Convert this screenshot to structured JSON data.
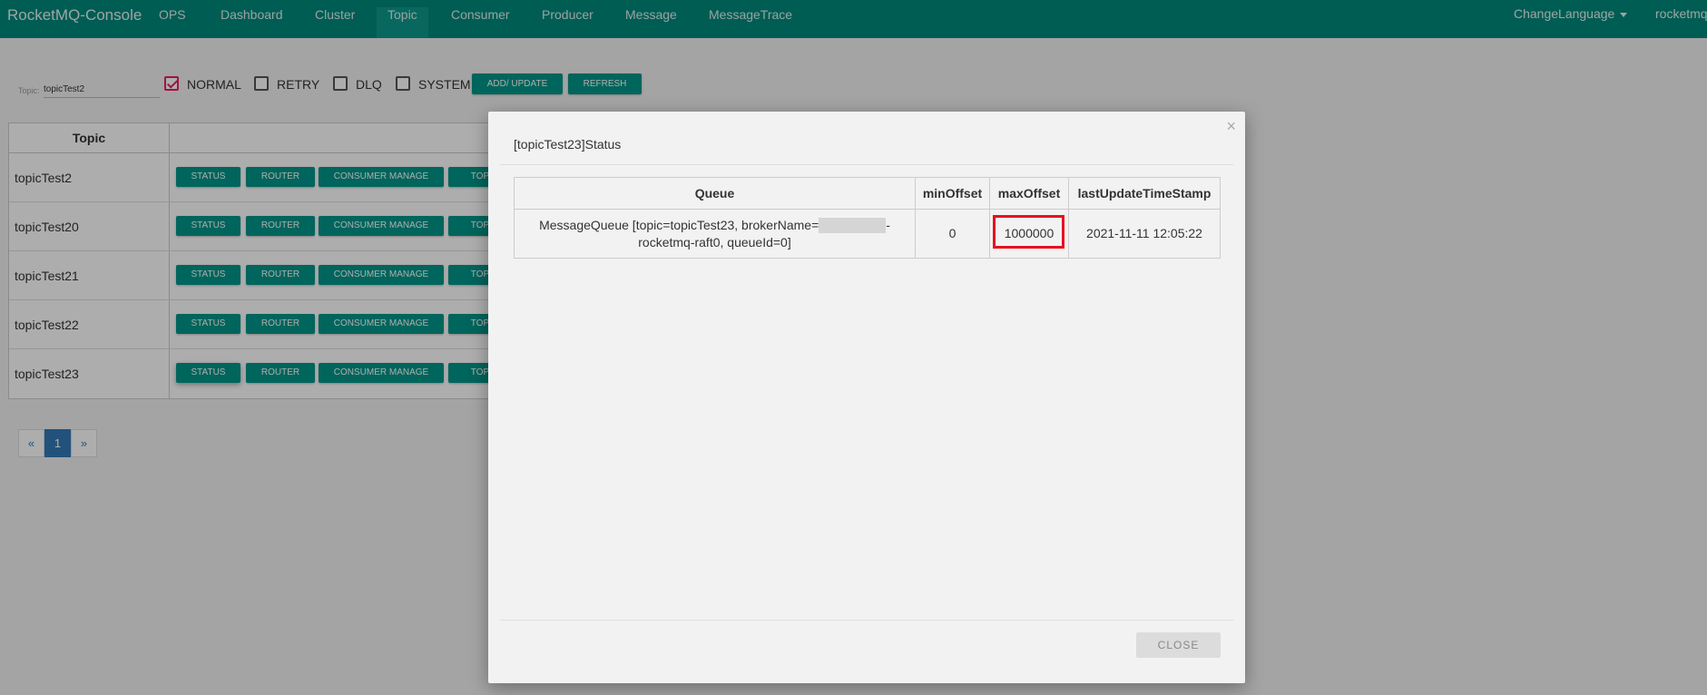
{
  "navbar": {
    "brand": "RocketMQ-Console",
    "items": [
      {
        "label": "OPS"
      },
      {
        "label": "Dashboard"
      },
      {
        "label": "Cluster"
      },
      {
        "label": "Topic"
      },
      {
        "label": "Consumer"
      },
      {
        "label": "Producer"
      },
      {
        "label": "Message"
      },
      {
        "label": "MessageTrace"
      }
    ],
    "active_item": "Topic",
    "change_language": "ChangeLanguage",
    "user": "rocketmq"
  },
  "filter": {
    "topic_label": "Topic:",
    "topic_value": "topicTest2",
    "checkboxes": [
      {
        "label": "NORMAL",
        "checked": true
      },
      {
        "label": "RETRY",
        "checked": false
      },
      {
        "label": "DLQ",
        "checked": false
      },
      {
        "label": "SYSTEM",
        "checked": false
      }
    ],
    "add_update_label": "ADD/ UPDATE",
    "refresh_label": "REFRESH"
  },
  "topic_table": {
    "header": "Topic",
    "row_buttons": {
      "status": "STATUS",
      "router": "ROUTER",
      "consumer_manage": "CONSUMER MANAGE",
      "topic_config": "TOPIC"
    },
    "rows": [
      {
        "name": "topicTest2"
      },
      {
        "name": "topicTest20"
      },
      {
        "name": "topicTest21"
      },
      {
        "name": "topicTest22"
      },
      {
        "name": "topicTest23"
      }
    ]
  },
  "pagination": {
    "prev": "«",
    "current": "1",
    "next": "»"
  },
  "modal": {
    "close_x": "×",
    "title": "[topicTest23]Status",
    "columns": {
      "queue": "Queue",
      "min_offset": "minOffset",
      "max_offset": "maxOffset",
      "last_update": "lastUpdateTimeStamp"
    },
    "row": {
      "queue_line1_prefix": "MessageQueue [topic=topicTest23, brokerName=",
      "queue_line1_suffix": "-",
      "queue_line2": "rocketmq-raft0, queueId=0]",
      "min_offset": "0",
      "max_offset": "1000000",
      "last_update": "2021-11-11 12:05:22"
    },
    "close_button": "CLOSE"
  },
  "colors": {
    "navbar": "#00897b",
    "button": "#009688",
    "highlight": "#e8101e",
    "checkbox_checked": "#e91e63"
  }
}
